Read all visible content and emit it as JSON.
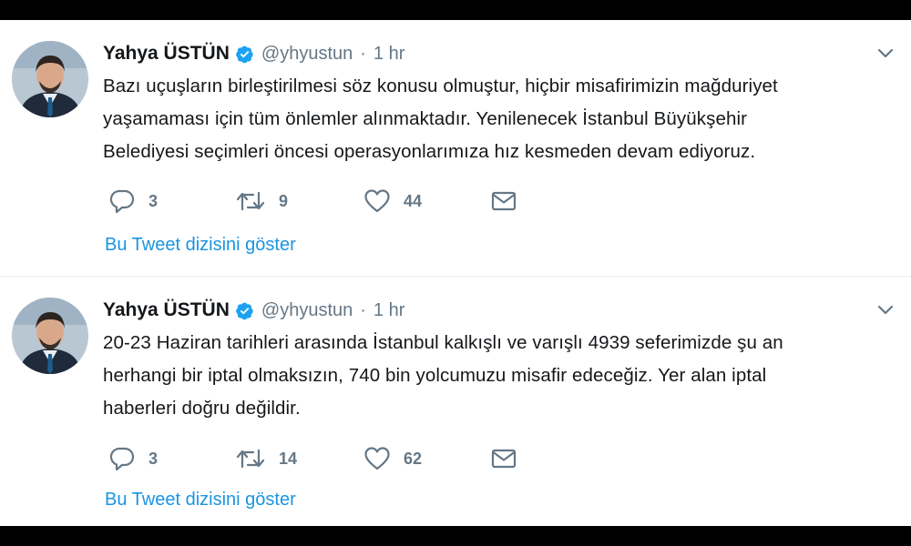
{
  "tweets": [
    {
      "author_name": "Yahya ÜSTÜN",
      "handle": "@yhyustun",
      "separator": "·",
      "time": "1 hr",
      "text_lines": [
        "Bazı uçuşların birleştirilmesi söz konusu olmuştur, hiçbir misafirimizin mağduriyet",
        "yaşamaması için tüm önlemler alınmaktadır. Yenilenecek İstanbul Büyükşehir",
        "Belediyesi seçimleri öncesi operasyonlarımıza hız kesmeden devam ediyoruz."
      ],
      "replies": "3",
      "retweets": "9",
      "likes": "44",
      "thread_link": "Bu Tweet dizisini göster"
    },
    {
      "author_name": "Yahya ÜSTÜN",
      "handle": "@yhyustun",
      "separator": "·",
      "time": "1 hr",
      "text_lines": [
        "20-23 Haziran tarihleri arasında İstanbul kalkışlı ve varışlı 4939 seferimizde şu an",
        "herhangi bir iptal olmaksızın, 740 bin yolcumuzu misafir edeceğiz. Yer alan iptal",
        "haberleri doğru değildir."
      ],
      "replies": "3",
      "retweets": "14",
      "likes": "62",
      "thread_link": "Bu Tweet dizisini göster"
    }
  ],
  "icons": {
    "verified": "verified-badge-icon",
    "caret": "chevron-down-icon",
    "reply": "reply-icon",
    "retweet": "retweet-icon",
    "like": "heart-icon",
    "dm": "envelope-icon"
  },
  "colors": {
    "action_gray": "#657786",
    "link_blue": "#1b95e0",
    "verified_blue": "#1da1f2",
    "text": "#14171a"
  }
}
